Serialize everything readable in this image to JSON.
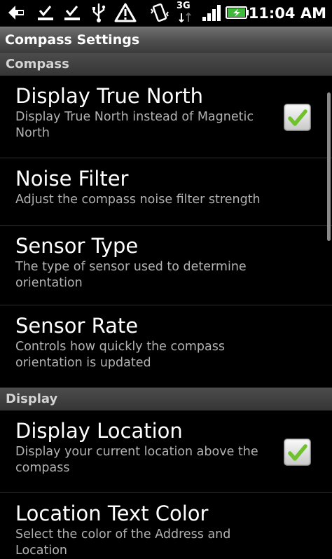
{
  "status_bar": {
    "time": "11:04 AM",
    "network_label": "3G",
    "icons": [
      "back-arrow-icon",
      "download-icon",
      "download-icon",
      "usb-icon",
      "warning-icon",
      "vibrate-icon",
      "3g-icon",
      "signal-icon",
      "battery-icon"
    ]
  },
  "title_bar": {
    "title": "Compass Settings"
  },
  "sections": [
    {
      "header": "Compass",
      "items": [
        {
          "title": "Display True North",
          "summary": "Display True North instead of Magnetic North",
          "checked": true
        },
        {
          "title": "Noise Filter",
          "summary": "Adjust the compass noise filter strength"
        },
        {
          "title": "Sensor Type",
          "summary": "The type of sensor used to determine orientation"
        },
        {
          "title": "Sensor Rate",
          "summary": "Controls how quickly the compass orientation is updated"
        }
      ]
    },
    {
      "header": "Display",
      "items": [
        {
          "title": "Display Location",
          "summary": "Display your current location above the compass",
          "checked": true
        },
        {
          "title": "Location Text Color",
          "summary": "Select the color of the Address and Location"
        }
      ]
    }
  ],
  "colors": {
    "check_green": "#6fc22c",
    "summary_text": "#b2b2b2",
    "category_text": "#d4d4d4"
  }
}
